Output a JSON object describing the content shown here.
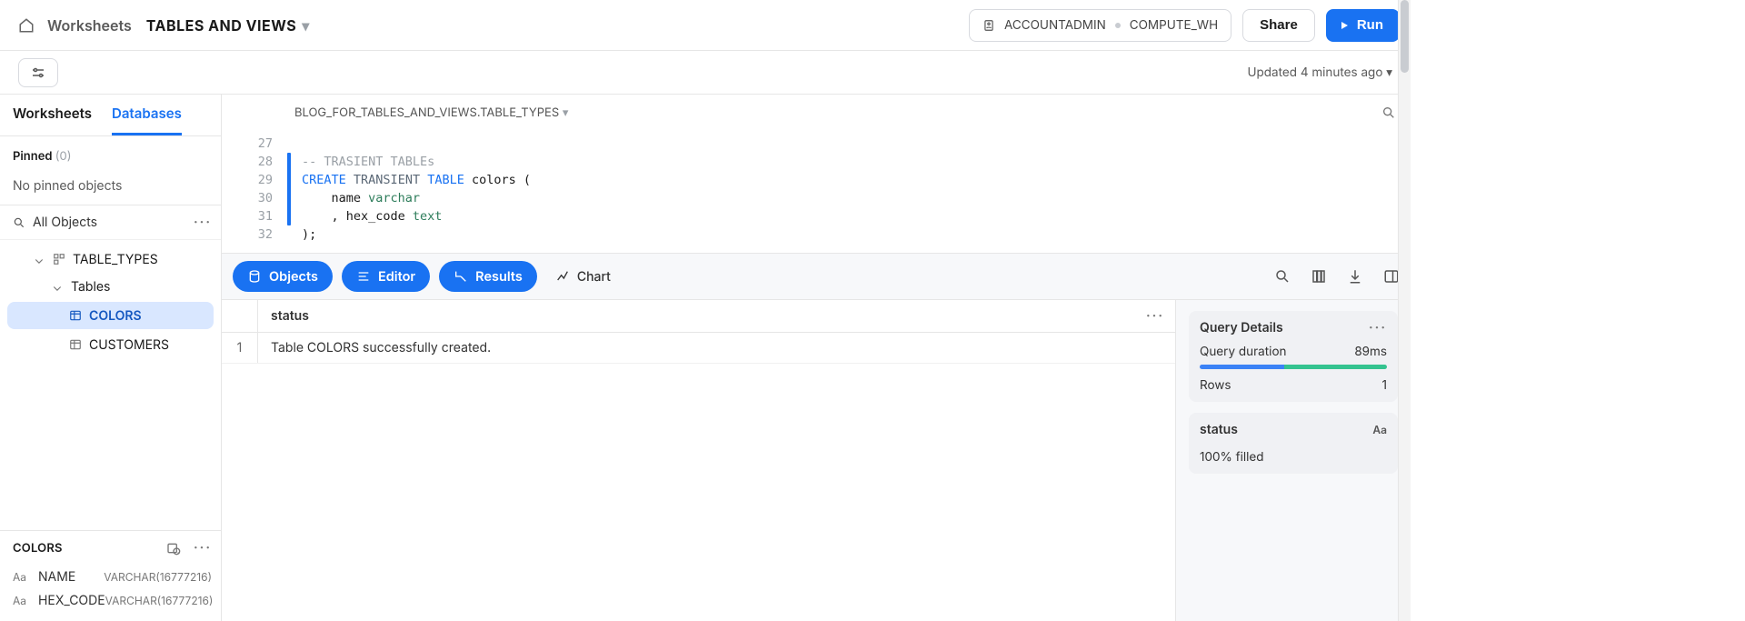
{
  "header": {
    "breadcrumb": "Worksheets",
    "title": "TABLES AND VIEWS",
    "role": "ACCOUNTADMIN",
    "warehouse": "COMPUTE_WH",
    "share": "Share",
    "run": "Run"
  },
  "subheader": {
    "updated": "Updated 4 minutes ago"
  },
  "sidebar": {
    "tabs": {
      "worksheets": "Worksheets",
      "databases": "Databases"
    },
    "pinned_label": "Pinned",
    "pinned_count": "(0)",
    "pinned_empty": "No pinned objects",
    "all_objects": "All Objects",
    "tree": {
      "schema": "TABLE_TYPES",
      "tables_label": "Tables",
      "items": [
        {
          "name": "COLORS",
          "selected": true
        },
        {
          "name": "CUSTOMERS",
          "selected": false
        }
      ]
    },
    "bottom": {
      "title": "COLORS",
      "columns": [
        {
          "name": "NAME",
          "type": "VARCHAR(16777216)"
        },
        {
          "name": "HEX_CODE",
          "type": "VARCHAR(16777216)"
        }
      ]
    }
  },
  "context": {
    "path": "BLOG_FOR_TABLES_AND_VIEWS.TABLE_TYPES"
  },
  "editor": {
    "gutter": [
      "27",
      "28",
      "29",
      "30",
      "31",
      "32"
    ],
    "line1": "",
    "comment": "-- TRASIENT TABLEs",
    "kw_create": "CREATE",
    "kw_transient": "TRANSIENT",
    "kw_table": "TABLE",
    "ident_colors": "colors (",
    "indent_name": "    name ",
    "type_varchar": "varchar",
    "indent_hex": "    , hex_code ",
    "type_text": "text",
    "close": ");"
  },
  "tabs2": {
    "objects": "Objects",
    "editor": "Editor",
    "results": "Results",
    "chart": "Chart"
  },
  "table": {
    "header": "status",
    "row": {
      "num": "1",
      "value": "Table COLORS successfully created."
    }
  },
  "details": {
    "title": "Query Details",
    "duration_label": "Query duration",
    "duration_value": "89ms",
    "bar_blue_pct": 45,
    "bar_green_pct": 55,
    "rows_label": "Rows",
    "rows_value": "1",
    "status_label": "status",
    "status_type": "Aa",
    "filled": "100% filled"
  }
}
